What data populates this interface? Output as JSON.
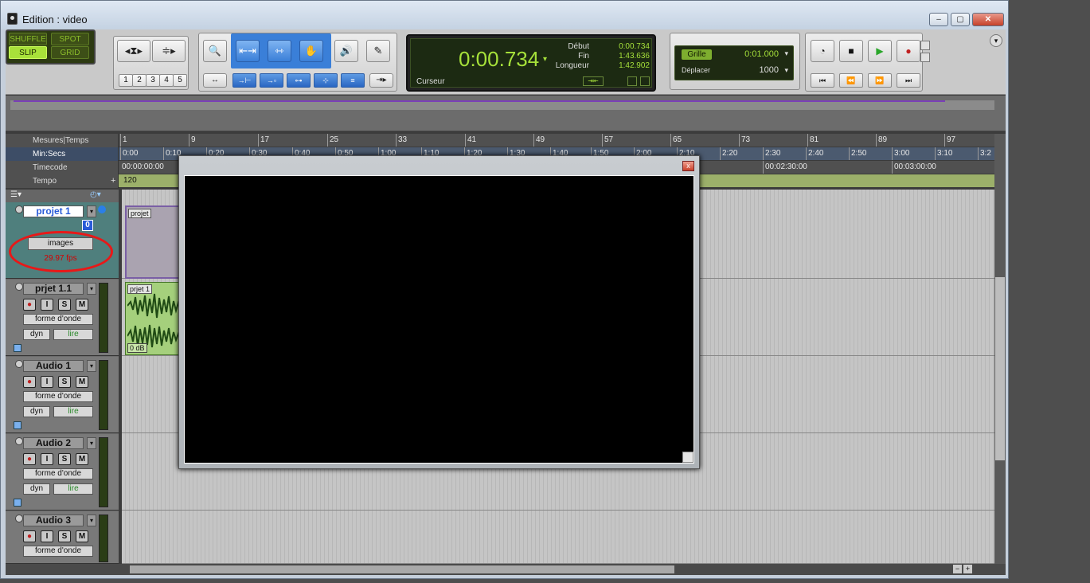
{
  "window": {
    "title": "Edition : video",
    "minimize": "–",
    "maximize": "▢",
    "close": "✕"
  },
  "modes": {
    "shuffle": "SHUFFLE",
    "spot": "SPOT",
    "slip": "SLIP",
    "grid": "GRID"
  },
  "zoom_presets": [
    "1",
    "2",
    "3",
    "4",
    "5"
  ],
  "counter": {
    "main": "0:00.734",
    "start_label": "Début",
    "start": "0:00.734",
    "end_label": "Fin",
    "end": "1:43.636",
    "length_label": "Longueur",
    "length": "1:42.902",
    "cursor_label": "Curseur"
  },
  "grid": {
    "label": "Grille",
    "value": "0:01.000",
    "nudge_label": "Déplacer",
    "nudge_value": "1000"
  },
  "rulers": {
    "bars_label": "Mesures|Temps",
    "bars": [
      "1",
      "9",
      "17",
      "25",
      "33",
      "41",
      "49",
      "57",
      "65",
      "73",
      "81",
      "89",
      "97"
    ],
    "minsecs_label": "Min:Secs",
    "minsecs": [
      "0:00",
      "0:10",
      "0:20",
      "0:30",
      "0:40",
      "0:50",
      "1:00",
      "1:10",
      "1:20",
      "1:30",
      "1:40",
      "1:50",
      "2:00",
      "2:10",
      "2:20",
      "2:30",
      "2:40",
      "2:50",
      "3:00",
      "3:10",
      "3:2"
    ],
    "timecode_label": "Timecode",
    "timecode": [
      "00:00:00:00",
      "00:02:30:00",
      "00:03:00:00"
    ],
    "tempo_label": "Tempo",
    "tempo_value": "120"
  },
  "tracks": [
    {
      "name": "projet 1",
      "format": "images",
      "fps": "29.97 fps",
      "badge": "0",
      "clip": "projet"
    },
    {
      "name": "prjet 1.1",
      "view": "forme d'onde",
      "auto": "dyn",
      "mode": "lire",
      "clip": "prjet 1",
      "gain": "0 dB"
    },
    {
      "name": "Audio 1",
      "view": "forme d'onde",
      "auto": "dyn",
      "mode": "lire"
    },
    {
      "name": "Audio 2",
      "view": "forme d'onde",
      "auto": "dyn",
      "mode": "lire"
    },
    {
      "name": "Audio 3",
      "view": "forme d'onde"
    }
  ],
  "track_buttons": {
    "rec": "●",
    "input": "I",
    "solo": "S",
    "mute": "M"
  },
  "video_window": {
    "close": "x"
  },
  "colors": {
    "counter_green": "#a6e13a",
    "fps_red": "#d40000",
    "highlight": "#e81818",
    "video_track": "#4f7f7d"
  }
}
